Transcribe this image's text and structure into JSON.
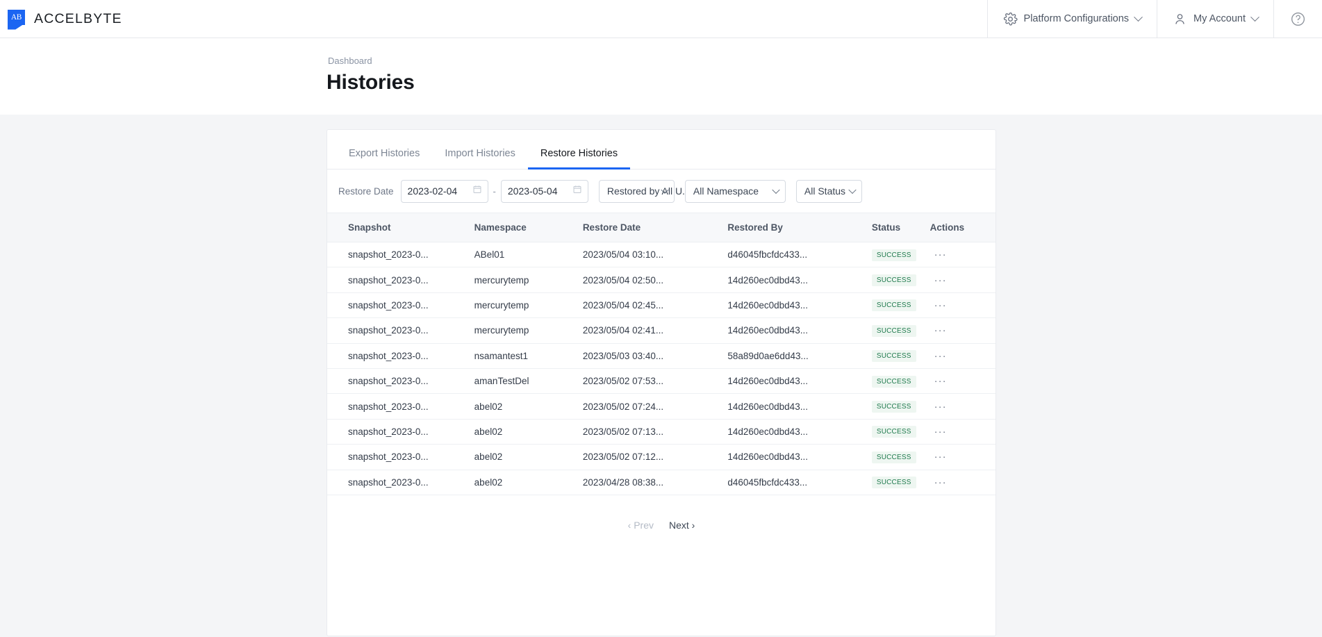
{
  "topbar": {
    "brand": "ACCELBYTE",
    "brand_mark_text": "AB",
    "platform_config": "Platform Configurations",
    "my_account": "My Account",
    "help_icon": "question-circle-icon",
    "gear_icon": "gear-icon",
    "user_icon": "user-icon"
  },
  "header": {
    "breadcrumb": "Dashboard",
    "title": "Histories"
  },
  "tabs": [
    {
      "label": "Export Histories",
      "active": false
    },
    {
      "label": "Import Histories",
      "active": false
    },
    {
      "label": "Restore Histories",
      "active": true
    }
  ],
  "filters": {
    "label": "Restore Date",
    "date_from": "2023-02-04",
    "date_to": "2023-05-04",
    "range_separator": "-",
    "restored_by": "Restored by All U...",
    "namespace": "All Namespace",
    "status": "All Status"
  },
  "table": {
    "columns": [
      "Snapshot",
      "Namespace",
      "Restore Date",
      "Restored By",
      "Status",
      "Actions"
    ],
    "rows": [
      {
        "snapshot": "snapshot_2023-0...",
        "namespace": "ABel01",
        "restore_date": "2023/05/04 03:10...",
        "restored_by": "d46045fbcfdc433...",
        "status": "SUCCESS",
        "actions": "···"
      },
      {
        "snapshot": "snapshot_2023-0...",
        "namespace": "mercurytemp",
        "restore_date": "2023/05/04 02:50...",
        "restored_by": "14d260ec0dbd43...",
        "status": "SUCCESS",
        "actions": "···"
      },
      {
        "snapshot": "snapshot_2023-0...",
        "namespace": "mercurytemp",
        "restore_date": "2023/05/04 02:45...",
        "restored_by": "14d260ec0dbd43...",
        "status": "SUCCESS",
        "actions": "···"
      },
      {
        "snapshot": "snapshot_2023-0...",
        "namespace": "mercurytemp",
        "restore_date": "2023/05/04 02:41...",
        "restored_by": "14d260ec0dbd43...",
        "status": "SUCCESS",
        "actions": "···"
      },
      {
        "snapshot": "snapshot_2023-0...",
        "namespace": "nsamantest1",
        "restore_date": "2023/05/03 03:40...",
        "restored_by": "58a89d0ae6dd43...",
        "status": "SUCCESS",
        "actions": "···"
      },
      {
        "snapshot": "snapshot_2023-0...",
        "namespace": "amanTestDel",
        "restore_date": "2023/05/02 07:53...",
        "restored_by": "14d260ec0dbd43...",
        "status": "SUCCESS",
        "actions": "···"
      },
      {
        "snapshot": "snapshot_2023-0...",
        "namespace": "abel02",
        "restore_date": "2023/05/02 07:24...",
        "restored_by": "14d260ec0dbd43...",
        "status": "SUCCESS",
        "actions": "···"
      },
      {
        "snapshot": "snapshot_2023-0...",
        "namespace": "abel02",
        "restore_date": "2023/05/02 07:13...",
        "restored_by": "14d260ec0dbd43...",
        "status": "SUCCESS",
        "actions": "···"
      },
      {
        "snapshot": "snapshot_2023-0...",
        "namespace": "abel02",
        "restore_date": "2023/05/02 07:12...",
        "restored_by": "14d260ec0dbd43...",
        "status": "SUCCESS",
        "actions": "···"
      },
      {
        "snapshot": "snapshot_2023-0...",
        "namespace": "abel02",
        "restore_date": "2023/04/28 08:38...",
        "restored_by": "d46045fbcfdc433...",
        "status": "SUCCESS",
        "actions": "···"
      }
    ]
  },
  "pagination": {
    "prev": "‹ Prev",
    "next": "Next ›"
  },
  "colors": {
    "accent": "#1b65f2",
    "success_text": "#1f7a4d",
    "success_bg": "#eef6f1",
    "page_bg": "#f4f5f7"
  }
}
